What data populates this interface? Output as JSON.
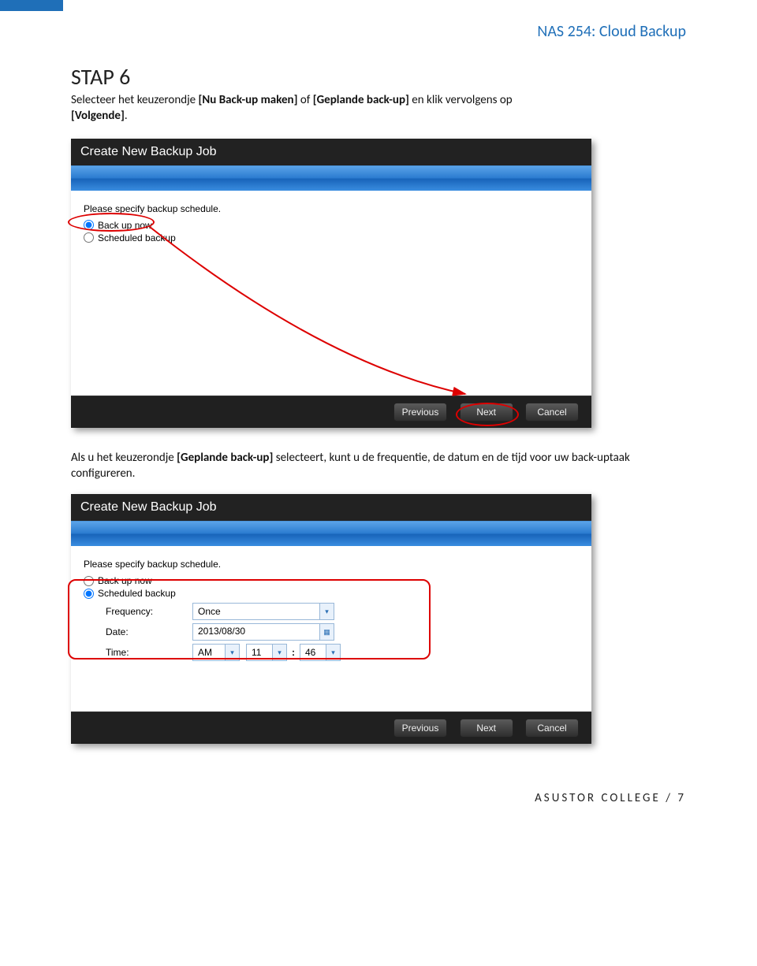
{
  "header": {
    "title": "NAS 254: Cloud Backup"
  },
  "intro": {
    "step": "STAP 6",
    "p1a": "Selecteer het keuzerondje ",
    "p1b": "[Nu Back-up maken]",
    "p1c": " of ",
    "p1d": "[Geplande back-up]",
    "p1e": " en klik vervolgens op ",
    "p1f": "[Volgende]",
    "p1g": "."
  },
  "dialog1": {
    "title": "Create New Backup Job",
    "prompt": "Please specify backup schedule.",
    "option_backup_now": "Back up now",
    "option_scheduled": "Scheduled backup",
    "btn_prev": "Previous",
    "btn_next": "Next",
    "btn_cancel": "Cancel"
  },
  "midtext": {
    "p1a": "Als u het keuzerondje ",
    "p1b": "[Geplande back-up]",
    "p1c": " selecteert, kunt u de frequentie, de datum en de tijd voor uw back-uptaak configureren."
  },
  "dialog2": {
    "title": "Create New Backup Job",
    "prompt": "Please specify backup schedule.",
    "option_backup_now": "Back up now",
    "option_scheduled": "Scheduled backup",
    "label_freq": "Frequency:",
    "label_date": "Date:",
    "label_time": "Time:",
    "val_freq": "Once",
    "val_date": "2013/08/30",
    "val_ampm": "AM",
    "val_hour": "11",
    "val_min": "46",
    "colon": ":",
    "btn_prev": "Previous",
    "btn_next": "Next",
    "btn_cancel": "Cancel"
  },
  "footer": {
    "text": "ASUSTOR COLLEGE / 7"
  }
}
